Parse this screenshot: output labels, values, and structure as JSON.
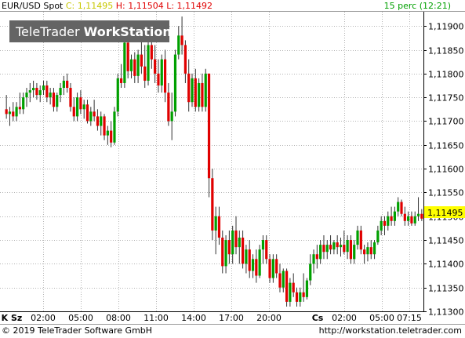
{
  "header": {
    "symbol": "EUR/USD Spot",
    "close_label": "C: 1,11495",
    "high_label": "H: 1,11504",
    "low_label": "L: 1,11492",
    "interval": "15 perc (12:21)"
  },
  "watermark": {
    "text_regular": "TeleTrader ",
    "text_bold": "WorkStation"
  },
  "footer": {
    "copyright": "© 2019 TeleTrader Software GmbH",
    "url": "http://workstation.teletrader.com"
  },
  "colors": {
    "up": "#00a000",
    "down": "#e00000",
    "grid": "#b4b4b4",
    "price_tag": "#ffff00",
    "close_text": "#c8c800",
    "high_low_text": "#e00000",
    "interval_text": "#00a000"
  },
  "chart_data": {
    "type": "candlestick",
    "title": "EUR/USD Spot",
    "y_range": [
      1.113,
      1.1193
    ],
    "y_ticks": [
      "1,11300",
      "1,11350",
      "1,11400",
      "1,11450",
      "1,11500",
      "1,11550",
      "1,11600",
      "1,11650",
      "1,11700",
      "1,11750",
      "1,11800",
      "1,11850",
      "1,11900"
    ],
    "x_ticks": [
      "K Sz",
      "02:00",
      "05:00",
      "08:00",
      "11:00",
      "14:00",
      "17:00",
      "20:00",
      "Cs",
      "02:00",
      "05:00",
      "07:15"
    ],
    "grid": true,
    "last_price": "1,11495",
    "series": [
      {
        "open": 1.11725,
        "high": 1.11755,
        "low": 1.11705,
        "close": 1.11715
      },
      {
        "open": 1.11715,
        "high": 1.1173,
        "low": 1.1169,
        "close": 1.1172
      },
      {
        "open": 1.1172,
        "high": 1.1174,
        "low": 1.117,
        "close": 1.1171
      },
      {
        "open": 1.1171,
        "high": 1.1174,
        "low": 1.117,
        "close": 1.1173
      },
      {
        "open": 1.1173,
        "high": 1.1176,
        "low": 1.11715,
        "close": 1.11725
      },
      {
        "open": 1.11725,
        "high": 1.1176,
        "low": 1.11715,
        "close": 1.1175
      },
      {
        "open": 1.1175,
        "high": 1.1177,
        "low": 1.1173,
        "close": 1.1176
      },
      {
        "open": 1.1176,
        "high": 1.1178,
        "low": 1.1174,
        "close": 1.11765
      },
      {
        "open": 1.11765,
        "high": 1.11785,
        "low": 1.1175,
        "close": 1.1177
      },
      {
        "open": 1.1177,
        "high": 1.1178,
        "low": 1.11745,
        "close": 1.11755
      },
      {
        "open": 1.11755,
        "high": 1.11775,
        "low": 1.1174,
        "close": 1.11765
      },
      {
        "open": 1.11765,
        "high": 1.11785,
        "low": 1.11755,
        "close": 1.11775
      },
      {
        "open": 1.11775,
        "high": 1.11785,
        "low": 1.1174,
        "close": 1.1175
      },
      {
        "open": 1.1175,
        "high": 1.1177,
        "low": 1.11735,
        "close": 1.1176
      },
      {
        "open": 1.1176,
        "high": 1.1177,
        "low": 1.1172,
        "close": 1.1173
      },
      {
        "open": 1.1173,
        "high": 1.1176,
        "low": 1.1172,
        "close": 1.11755
      },
      {
        "open": 1.11755,
        "high": 1.1178,
        "low": 1.1174,
        "close": 1.1177
      },
      {
        "open": 1.1177,
        "high": 1.11795,
        "low": 1.11755,
        "close": 1.11785
      },
      {
        "open": 1.11785,
        "high": 1.118,
        "low": 1.1176,
        "close": 1.1177
      },
      {
        "open": 1.1177,
        "high": 1.1178,
        "low": 1.1172,
        "close": 1.1173
      },
      {
        "open": 1.1173,
        "high": 1.1175,
        "low": 1.117,
        "close": 1.1171
      },
      {
        "open": 1.1171,
        "high": 1.1176,
        "low": 1.117,
        "close": 1.1175
      },
      {
        "open": 1.1175,
        "high": 1.11765,
        "low": 1.11715,
        "close": 1.11725
      },
      {
        "open": 1.11725,
        "high": 1.11745,
        "low": 1.11705,
        "close": 1.11735
      },
      {
        "open": 1.11735,
        "high": 1.11745,
        "low": 1.11695,
        "close": 1.117
      },
      {
        "open": 1.117,
        "high": 1.1173,
        "low": 1.1169,
        "close": 1.1172
      },
      {
        "open": 1.1172,
        "high": 1.11745,
        "low": 1.117,
        "close": 1.1171
      },
      {
        "open": 1.1171,
        "high": 1.11725,
        "low": 1.1168,
        "close": 1.1169
      },
      {
        "open": 1.1169,
        "high": 1.1172,
        "low": 1.1167,
        "close": 1.1171
      },
      {
        "open": 1.1171,
        "high": 1.11715,
        "low": 1.1166,
        "close": 1.1167
      },
      {
        "open": 1.1167,
        "high": 1.1169,
        "low": 1.1165,
        "close": 1.1168
      },
      {
        "open": 1.1168,
        "high": 1.117,
        "low": 1.11645,
        "close": 1.11655
      },
      {
        "open": 1.11655,
        "high": 1.1173,
        "low": 1.1165,
        "close": 1.1172
      },
      {
        "open": 1.1172,
        "high": 1.118,
        "low": 1.1171,
        "close": 1.1179
      },
      {
        "open": 1.1179,
        "high": 1.1182,
        "low": 1.1177,
        "close": 1.1178
      },
      {
        "open": 1.1178,
        "high": 1.1188,
        "low": 1.1177,
        "close": 1.11865
      },
      {
        "open": 1.11865,
        "high": 1.1188,
        "low": 1.1179,
        "close": 1.11805
      },
      {
        "open": 1.11805,
        "high": 1.1184,
        "low": 1.1179,
        "close": 1.1183
      },
      {
        "open": 1.1183,
        "high": 1.11845,
        "low": 1.1178,
        "close": 1.11795
      },
      {
        "open": 1.11795,
        "high": 1.1185,
        "low": 1.1178,
        "close": 1.1184
      },
      {
        "open": 1.1184,
        "high": 1.1188,
        "low": 1.118,
        "close": 1.11815
      },
      {
        "open": 1.11815,
        "high": 1.1186,
        "low": 1.1177,
        "close": 1.11785
      },
      {
        "open": 1.11785,
        "high": 1.1187,
        "low": 1.11775,
        "close": 1.1186
      },
      {
        "open": 1.1186,
        "high": 1.1188,
        "low": 1.1181,
        "close": 1.1183
      },
      {
        "open": 1.1183,
        "high": 1.1186,
        "low": 1.1178,
        "close": 1.118
      },
      {
        "open": 1.118,
        "high": 1.1183,
        "low": 1.1176,
        "close": 1.11775
      },
      {
        "open": 1.11775,
        "high": 1.1184,
        "low": 1.1176,
        "close": 1.1183
      },
      {
        "open": 1.1183,
        "high": 1.1185,
        "low": 1.1174,
        "close": 1.1176
      },
      {
        "open": 1.1176,
        "high": 1.1178,
        "low": 1.1169,
        "close": 1.117
      },
      {
        "open": 1.117,
        "high": 1.1176,
        "low": 1.1166,
        "close": 1.1172
      },
      {
        "open": 1.1172,
        "high": 1.1185,
        "low": 1.1171,
        "close": 1.1184
      },
      {
        "open": 1.1184,
        "high": 1.119,
        "low": 1.1183,
        "close": 1.1188
      },
      {
        "open": 1.1188,
        "high": 1.1192,
        "low": 1.1184,
        "close": 1.1186
      },
      {
        "open": 1.1186,
        "high": 1.1187,
        "low": 1.1178,
        "close": 1.118
      },
      {
        "open": 1.118,
        "high": 1.1183,
        "low": 1.1172,
        "close": 1.1174
      },
      {
        "open": 1.1174,
        "high": 1.118,
        "low": 1.1173,
        "close": 1.1179
      },
      {
        "open": 1.1179,
        "high": 1.1181,
        "low": 1.1172,
        "close": 1.1173
      },
      {
        "open": 1.1173,
        "high": 1.1179,
        "low": 1.1172,
        "close": 1.1178
      },
      {
        "open": 1.1178,
        "high": 1.118,
        "low": 1.1172,
        "close": 1.1173
      },
      {
        "open": 1.1173,
        "high": 1.1181,
        "low": 1.1172,
        "close": 1.118
      },
      {
        "open": 1.118,
        "high": 1.118,
        "low": 1.1154,
        "close": 1.1158
      },
      {
        "open": 1.1158,
        "high": 1.116,
        "low": 1.1145,
        "close": 1.1147
      },
      {
        "open": 1.1147,
        "high": 1.1152,
        "low": 1.1142,
        "close": 1.115
      },
      {
        "open": 1.115,
        "high": 1.1152,
        "low": 1.1144,
        "close": 1.11455
      },
      {
        "open": 1.11455,
        "high": 1.1147,
        "low": 1.1138,
        "close": 1.11395
      },
      {
        "open": 1.11395,
        "high": 1.1146,
        "low": 1.1138,
        "close": 1.1145
      },
      {
        "open": 1.1145,
        "high": 1.1147,
        "low": 1.114,
        "close": 1.1142
      },
      {
        "open": 1.1142,
        "high": 1.1148,
        "low": 1.114,
        "close": 1.1147
      },
      {
        "open": 1.1147,
        "high": 1.115,
        "low": 1.1142,
        "close": 1.11435
      },
      {
        "open": 1.11435,
        "high": 1.1147,
        "low": 1.114,
        "close": 1.11455
      },
      {
        "open": 1.11455,
        "high": 1.1147,
        "low": 1.1139,
        "close": 1.114
      },
      {
        "open": 1.114,
        "high": 1.1144,
        "low": 1.1138,
        "close": 1.1143
      },
      {
        "open": 1.1143,
        "high": 1.1145,
        "low": 1.1137,
        "close": 1.11385
      },
      {
        "open": 1.11385,
        "high": 1.1142,
        "low": 1.1137,
        "close": 1.1141
      },
      {
        "open": 1.1141,
        "high": 1.1143,
        "low": 1.1136,
        "close": 1.11375
      },
      {
        "open": 1.11375,
        "high": 1.1144,
        "low": 1.1137,
        "close": 1.1143
      },
      {
        "open": 1.1143,
        "high": 1.1146,
        "low": 1.114,
        "close": 1.1145
      },
      {
        "open": 1.1145,
        "high": 1.1146,
        "low": 1.114,
        "close": 1.1141
      },
      {
        "open": 1.1141,
        "high": 1.1142,
        "low": 1.1136,
        "close": 1.1137
      },
      {
        "open": 1.1137,
        "high": 1.1142,
        "low": 1.1136,
        "close": 1.1141
      },
      {
        "open": 1.1141,
        "high": 1.1142,
        "low": 1.1137,
        "close": 1.1138
      },
      {
        "open": 1.1138,
        "high": 1.114,
        "low": 1.1134,
        "close": 1.1135
      },
      {
        "open": 1.1135,
        "high": 1.1139,
        "low": 1.1134,
        "close": 1.11385
      },
      {
        "open": 1.11385,
        "high": 1.1139,
        "low": 1.1131,
        "close": 1.1132
      },
      {
        "open": 1.1132,
        "high": 1.1137,
        "low": 1.1131,
        "close": 1.1136
      },
      {
        "open": 1.1136,
        "high": 1.1138,
        "low": 1.1133,
        "close": 1.1134
      },
      {
        "open": 1.1134,
        "high": 1.1135,
        "low": 1.1131,
        "close": 1.1132
      },
      {
        "open": 1.1132,
        "high": 1.1135,
        "low": 1.1131,
        "close": 1.1134
      },
      {
        "open": 1.1134,
        "high": 1.1138,
        "low": 1.1132,
        "close": 1.1133
      },
      {
        "open": 1.1133,
        "high": 1.1137,
        "low": 1.11325,
        "close": 1.11365
      },
      {
        "open": 1.11365,
        "high": 1.1142,
        "low": 1.11355,
        "close": 1.114
      },
      {
        "open": 1.114,
        "high": 1.1143,
        "low": 1.1138,
        "close": 1.1142
      },
      {
        "open": 1.1142,
        "high": 1.1144,
        "low": 1.1139,
        "close": 1.1141
      },
      {
        "open": 1.1141,
        "high": 1.1145,
        "low": 1.114,
        "close": 1.1144
      },
      {
        "open": 1.1144,
        "high": 1.1146,
        "low": 1.1141,
        "close": 1.11425
      },
      {
        "open": 1.11425,
        "high": 1.1145,
        "low": 1.1141,
        "close": 1.1144
      },
      {
        "open": 1.1144,
        "high": 1.1146,
        "low": 1.1142,
        "close": 1.1143
      },
      {
        "open": 1.1143,
        "high": 1.1145,
        "low": 1.1142,
        "close": 1.11445
      },
      {
        "open": 1.11445,
        "high": 1.1146,
        "low": 1.1142,
        "close": 1.11435
      },
      {
        "open": 1.11435,
        "high": 1.11455,
        "low": 1.11415,
        "close": 1.1144
      },
      {
        "open": 1.1144,
        "high": 1.1147,
        "low": 1.1142,
        "close": 1.11425
      },
      {
        "open": 1.11425,
        "high": 1.1146,
        "low": 1.1141,
        "close": 1.1145
      },
      {
        "open": 1.1145,
        "high": 1.1146,
        "low": 1.114,
        "close": 1.1141
      },
      {
        "open": 1.1141,
        "high": 1.1145,
        "low": 1.114,
        "close": 1.1144
      },
      {
        "open": 1.1144,
        "high": 1.1148,
        "low": 1.1143,
        "close": 1.1147
      },
      {
        "open": 1.1147,
        "high": 1.1148,
        "low": 1.1142,
        "close": 1.1143
      },
      {
        "open": 1.1143,
        "high": 1.1144,
        "low": 1.114,
        "close": 1.1142
      },
      {
        "open": 1.1142,
        "high": 1.11445,
        "low": 1.11405,
        "close": 1.11435
      },
      {
        "open": 1.11435,
        "high": 1.1145,
        "low": 1.1141,
        "close": 1.1142
      },
      {
        "open": 1.1142,
        "high": 1.1145,
        "low": 1.1141,
        "close": 1.11445
      },
      {
        "open": 1.11445,
        "high": 1.1148,
        "low": 1.1144,
        "close": 1.1147
      },
      {
        "open": 1.1147,
        "high": 1.115,
        "low": 1.1146,
        "close": 1.1149
      },
      {
        "open": 1.1149,
        "high": 1.115,
        "low": 1.1146,
        "close": 1.1148
      },
      {
        "open": 1.1148,
        "high": 1.1151,
        "low": 1.1147,
        "close": 1.115
      },
      {
        "open": 1.115,
        "high": 1.1152,
        "low": 1.1148,
        "close": 1.1149
      },
      {
        "open": 1.1149,
        "high": 1.1152,
        "low": 1.1148,
        "close": 1.1151
      },
      {
        "open": 1.1151,
        "high": 1.1154,
        "low": 1.115,
        "close": 1.1153
      },
      {
        "open": 1.1153,
        "high": 1.11535,
        "low": 1.115,
        "close": 1.11505
      },
      {
        "open": 1.11505,
        "high": 1.1152,
        "low": 1.1148,
        "close": 1.1149
      },
      {
        "open": 1.1149,
        "high": 1.1151,
        "low": 1.1148,
        "close": 1.115
      },
      {
        "open": 1.115,
        "high": 1.1151,
        "low": 1.1148,
        "close": 1.11485
      },
      {
        "open": 1.11485,
        "high": 1.1151,
        "low": 1.1148,
        "close": 1.115
      },
      {
        "open": 1.115,
        "high": 1.1154,
        "low": 1.1149,
        "close": 1.11505
      },
      {
        "open": 1.11505,
        "high": 1.11515,
        "low": 1.1149,
        "close": 1.11495
      }
    ]
  }
}
